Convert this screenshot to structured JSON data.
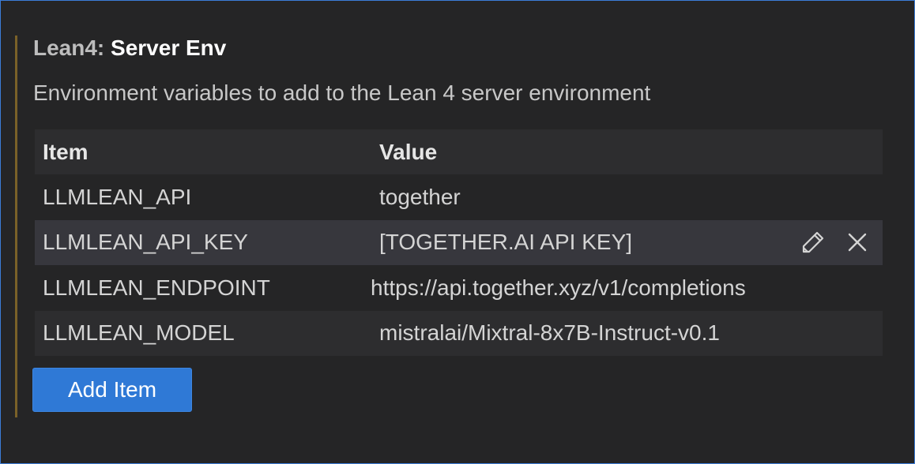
{
  "setting": {
    "category": "Lean4: ",
    "name": "Server Env",
    "description": "Environment variables to add to the Lean 4 server environment"
  },
  "table": {
    "headers": {
      "item": "Item",
      "value": "Value"
    },
    "rows": [
      {
        "key": "LLMLEAN_API",
        "value": "together"
      },
      {
        "key": "LLMLEAN_API_KEY",
        "value": "[TOGETHER.AI API KEY]"
      },
      {
        "key": "LLMLEAN_ENDPOINT",
        "value": "https://api.together.xyz/v1/completions"
      },
      {
        "key": "LLMLEAN_MODEL",
        "value": "mistralai/Mixtral-8x7B-Instruct-v0.1"
      }
    ],
    "row_actions": [
      "pencil-icon",
      "close-icon"
    ]
  },
  "add_button": {
    "label": "Add Item"
  },
  "colors": {
    "background": "#252526",
    "focus_border": "#3b7dd8",
    "modified_indicator": "#7a6128",
    "button": "#2f79d6"
  }
}
